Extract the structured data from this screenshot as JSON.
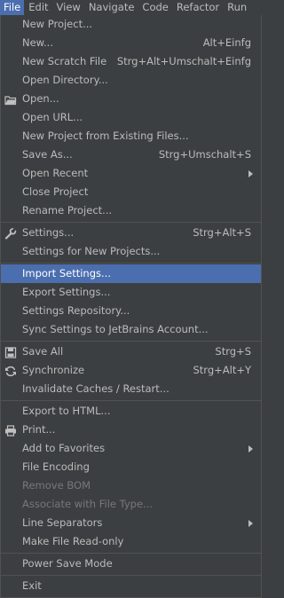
{
  "menubar": [
    {
      "label": "File",
      "active": true
    },
    {
      "label": "Edit"
    },
    {
      "label": "View"
    },
    {
      "label": "Navigate"
    },
    {
      "label": "Code"
    },
    {
      "label": "Refactor"
    },
    {
      "label": "Run"
    }
  ],
  "groups": [
    [
      {
        "label": "New Project...",
        "name": "new-project"
      },
      {
        "label": "New...",
        "shortcut": "Alt+Einfg",
        "name": "new"
      },
      {
        "label": "New Scratch File",
        "shortcut": "Strg+Alt+Umschalt+Einfg",
        "name": "new-scratch-file"
      },
      {
        "label": "Open Directory...",
        "name": "open-directory"
      },
      {
        "label": "Open...",
        "icon": "folder-icon",
        "name": "open"
      },
      {
        "label": "Open URL...",
        "name": "open-url"
      },
      {
        "label": "New Project from Existing Files...",
        "name": "new-project-from-existing"
      },
      {
        "label": "Save As...",
        "shortcut": "Strg+Umschalt+S",
        "name": "save-as"
      },
      {
        "label": "Open Recent",
        "submenu": true,
        "name": "open-recent"
      },
      {
        "label": "Close Project",
        "name": "close-project"
      },
      {
        "label": "Rename Project...",
        "name": "rename-project"
      }
    ],
    [
      {
        "label": "Settings...",
        "shortcut": "Strg+Alt+S",
        "icon": "wrench-icon",
        "name": "settings"
      },
      {
        "label": "Settings for New Projects...",
        "name": "settings-new-projects"
      }
    ],
    [
      {
        "label": "Import Settings...",
        "highlighted": true,
        "name": "import-settings"
      },
      {
        "label": "Export Settings...",
        "name": "export-settings"
      },
      {
        "label": "Settings Repository...",
        "name": "settings-repository"
      },
      {
        "label": "Sync Settings to JetBrains Account...",
        "name": "sync-settings"
      }
    ],
    [
      {
        "label": "Save All",
        "shortcut": "Strg+S",
        "icon": "save-icon",
        "name": "save-all"
      },
      {
        "label": "Synchronize",
        "shortcut": "Strg+Alt+Y",
        "icon": "sync-icon",
        "name": "synchronize"
      },
      {
        "label": "Invalidate Caches / Restart...",
        "name": "invalidate-caches"
      }
    ],
    [
      {
        "label": "Export to HTML...",
        "name": "export-html"
      },
      {
        "label": "Print...",
        "icon": "printer-icon",
        "name": "print"
      },
      {
        "label": "Add to Favorites",
        "submenu": true,
        "name": "add-to-favorites"
      },
      {
        "label": "File Encoding",
        "name": "file-encoding"
      },
      {
        "label": "Remove BOM",
        "disabled": true,
        "name": "remove-bom"
      },
      {
        "label": "Associate with File Type...",
        "disabled": true,
        "name": "associate-file-type"
      },
      {
        "label": "Line Separators",
        "submenu": true,
        "name": "line-separators"
      },
      {
        "label": "Make File Read-only",
        "name": "make-read-only"
      }
    ],
    [
      {
        "label": "Power Save Mode",
        "name": "power-save-mode"
      }
    ],
    [
      {
        "label": "Exit",
        "name": "exit"
      }
    ]
  ],
  "colors": {
    "background": "#3c3f41",
    "highlight": "#4b6eaf",
    "text": "#bbbbbb",
    "disabled": "#777777",
    "separator": "#515151"
  }
}
